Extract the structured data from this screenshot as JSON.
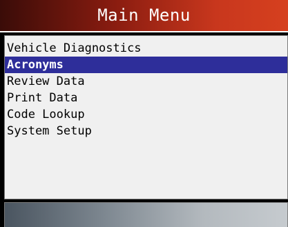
{
  "header": {
    "title": "Main Menu",
    "gradient": [
      "#3a0c08",
      "#d6401f"
    ]
  },
  "menu": {
    "selected_index": 1,
    "highlight_color": "#2e2e9a",
    "items": [
      {
        "label": "Vehicle Diagnostics"
      },
      {
        "label": "Acronyms"
      },
      {
        "label": "Review Data"
      },
      {
        "label": "Print Data"
      },
      {
        "label": "Code Lookup"
      },
      {
        "label": "System Setup"
      }
    ]
  },
  "footer": {
    "gradient": [
      "#4a5560",
      "#c6cbcf"
    ]
  }
}
